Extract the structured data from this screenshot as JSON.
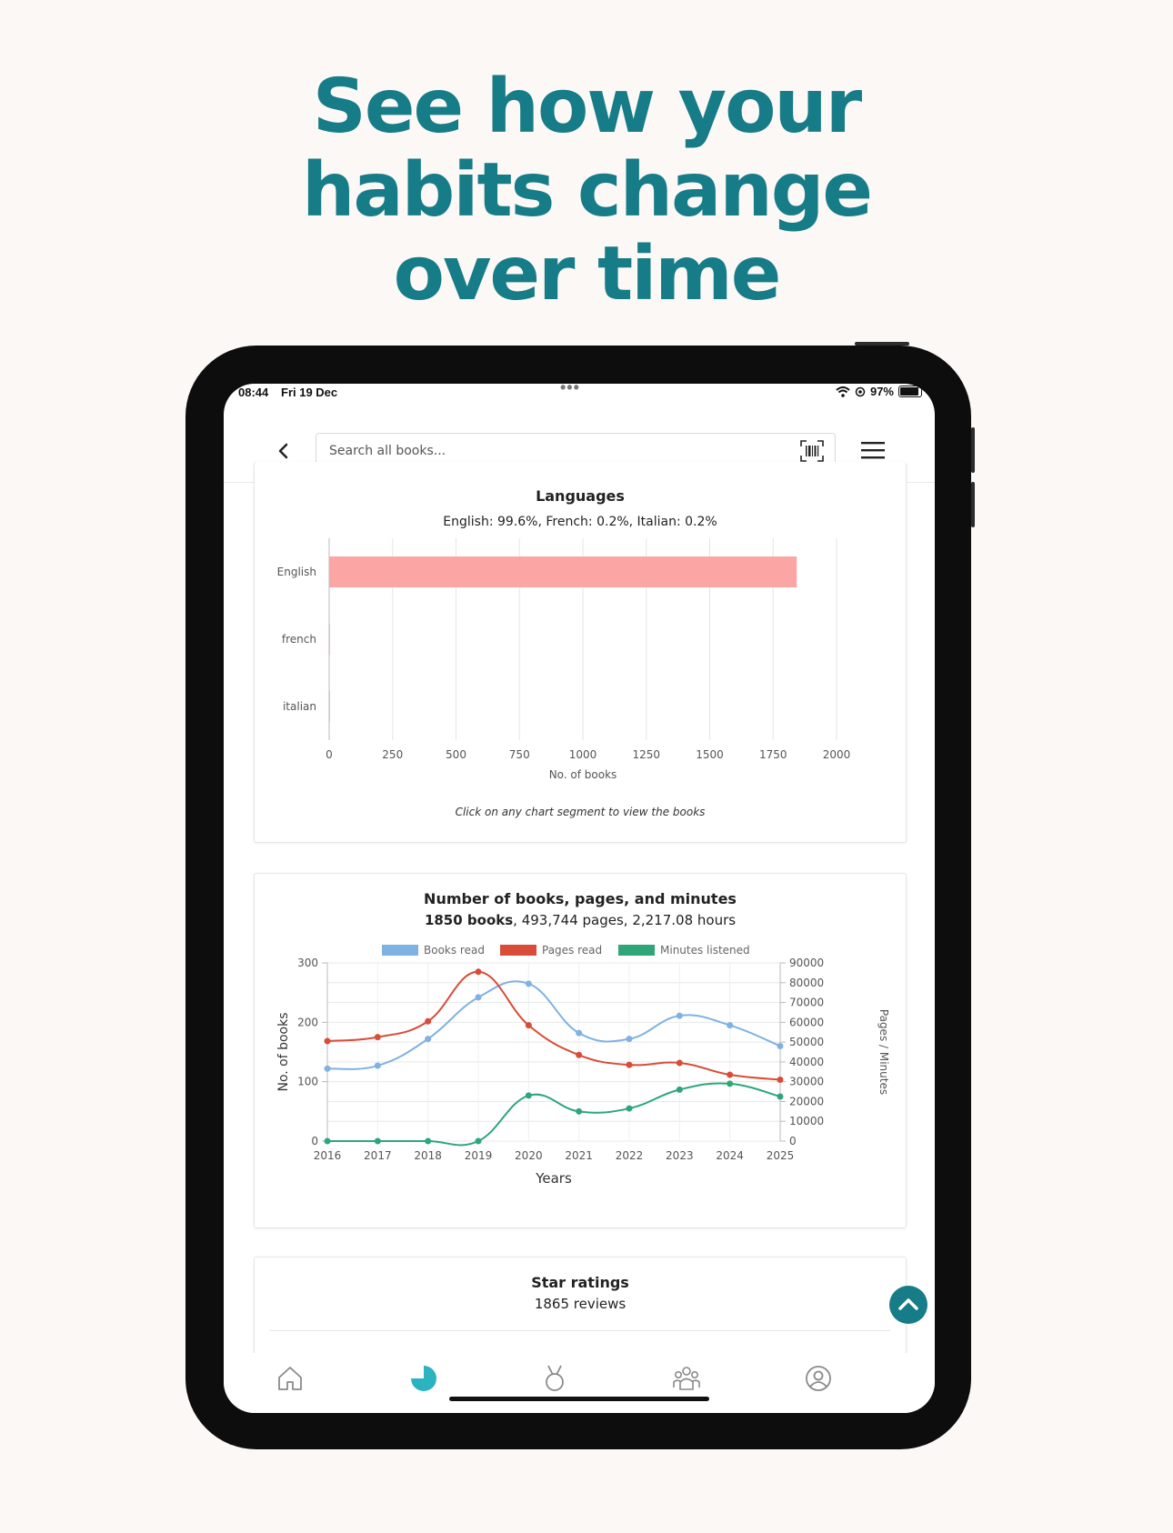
{
  "headline": {
    "line1": "See how your",
    "line2": "habits change",
    "line3": "over time"
  },
  "status_bar": {
    "time": "08:44",
    "date": "Fri 19 Dec",
    "multitask_dots": "•••",
    "battery": "97%"
  },
  "search": {
    "placeholder": "Search all books..."
  },
  "languages_card": {
    "title": "Languages",
    "summary": "English: 99.6%, French: 0.2%, Italian: 0.2%",
    "note": "Click on any chart segment to view the books"
  },
  "books_card": {
    "title": "Number of books, pages, and minutes",
    "summary_bold": "1850 books",
    "summary_rest": ", 493,744 pages, 2,217.08 hours"
  },
  "ratings_card": {
    "title": "Star ratings",
    "summary": "1865 reviews"
  },
  "tabs": [
    "home-icon",
    "stats-pie-icon",
    "medal-icon",
    "community-icon",
    "profile-icon"
  ],
  "colors": {
    "accent": "#167c87",
    "bar": "#fca5a5",
    "books": "#7fb2e3",
    "pages": "#d94c38",
    "minutes": "#2ea67a"
  },
  "chart_data": [
    {
      "type": "bar",
      "orientation": "horizontal",
      "categories": [
        "English",
        "french",
        "italian"
      ],
      "values": [
        1843,
        3,
        3
      ],
      "xlabel": "No. of books",
      "xlim": [
        0,
        2000
      ],
      "xticks": [
        0,
        250,
        500,
        750,
        1000,
        1250,
        1500,
        1750,
        2000
      ],
      "grid": true
    },
    {
      "type": "line",
      "x": [
        2016,
        2017,
        2018,
        2019,
        2020,
        2021,
        2022,
        2023,
        2024,
        2025
      ],
      "xlabel": "Years",
      "ylabel": "No. of books",
      "ylabel_right": "Pages / Minutes",
      "ylim": [
        0,
        300
      ],
      "ylim_right": [
        0,
        90000
      ],
      "yticks": [
        0,
        100,
        200,
        300
      ],
      "yticks_right": [
        0,
        10000,
        20000,
        30000,
        40000,
        50000,
        60000,
        70000,
        80000,
        90000
      ],
      "legend": "top",
      "grid": true,
      "series": [
        {
          "name": "Books read",
          "axis": "left",
          "values": [
            122,
            127,
            172,
            242,
            265,
            182,
            172,
            211,
            195,
            160
          ]
        },
        {
          "name": "Pages read",
          "axis": "right",
          "values": [
            50500,
            52500,
            60500,
            85500,
            58500,
            43500,
            38500,
            39500,
            33500,
            31000
          ]
        },
        {
          "name": "Minutes listened",
          "axis": "right",
          "values": [
            0,
            0,
            0,
            0,
            23000,
            15000,
            16500,
            26000,
            29000,
            22500
          ]
        }
      ]
    }
  ]
}
